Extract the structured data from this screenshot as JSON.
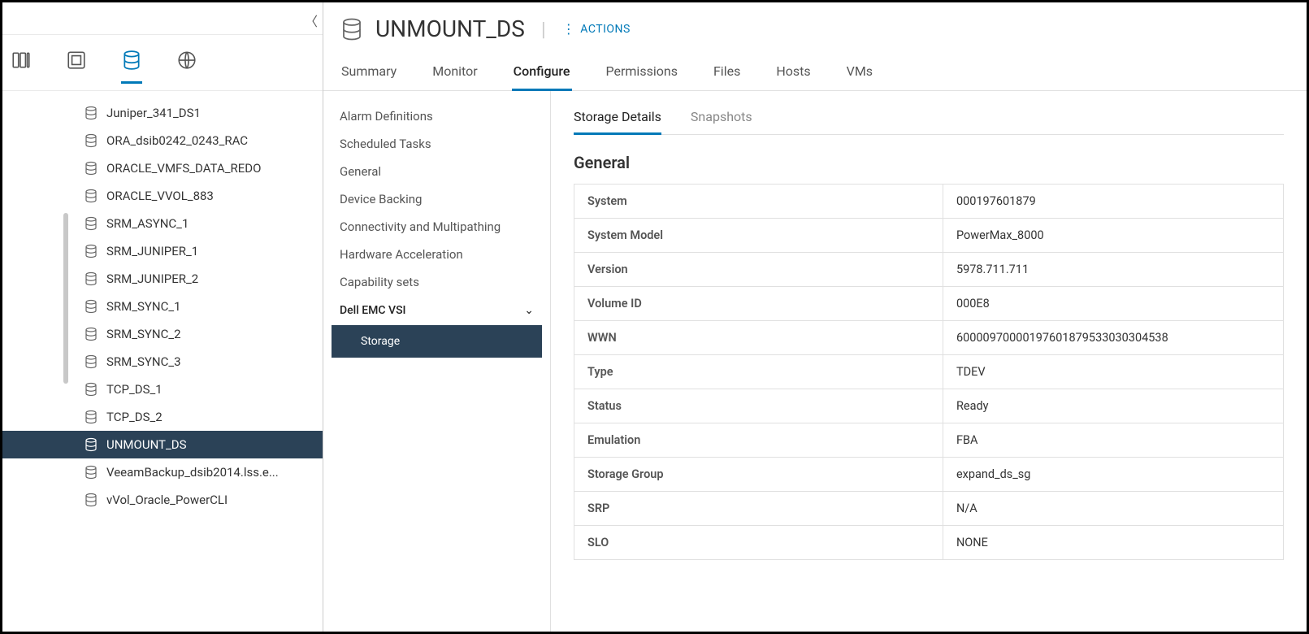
{
  "header": {
    "page_title": "UNMOUNT_DS",
    "actions_label": "ACTIONS"
  },
  "sidebar": {
    "items": [
      {
        "label": "Juniper_341_DS1"
      },
      {
        "label": "ORA_dsib0242_0243_RAC"
      },
      {
        "label": "ORACLE_VMFS_DATA_REDO"
      },
      {
        "label": "ORACLE_VVOL_883"
      },
      {
        "label": "SRM_ASYNC_1"
      },
      {
        "label": "SRM_JUNIPER_1"
      },
      {
        "label": "SRM_JUNIPER_2"
      },
      {
        "label": "SRM_SYNC_1"
      },
      {
        "label": "SRM_SYNC_2"
      },
      {
        "label": "SRM_SYNC_3"
      },
      {
        "label": "TCP_DS_1"
      },
      {
        "label": "TCP_DS_2"
      },
      {
        "label": "UNMOUNT_DS",
        "selected": true
      },
      {
        "label": "VeeamBackup_dsib2014.lss.e..."
      },
      {
        "label": "vVol_Oracle_PowerCLI"
      }
    ]
  },
  "main_tabs": [
    {
      "label": "Summary"
    },
    {
      "label": "Monitor"
    },
    {
      "label": "Configure",
      "active": true
    },
    {
      "label": "Permissions"
    },
    {
      "label": "Files"
    },
    {
      "label": "Hosts"
    },
    {
      "label": "VMs"
    }
  ],
  "config_nav": {
    "items": [
      "Alarm Definitions",
      "Scheduled Tasks",
      "General",
      "Device Backing",
      "Connectivity and Multipathing",
      "Hardware Acceleration",
      "Capability sets"
    ],
    "group": "Dell EMC VSI",
    "sub_selected": "Storage"
  },
  "sub_tabs": [
    {
      "label": "Storage Details",
      "active": true
    },
    {
      "label": "Snapshots"
    }
  ],
  "details": {
    "section_title": "General",
    "rows": [
      {
        "k": "System",
        "v": "000197601879"
      },
      {
        "k": "System Model",
        "v": "PowerMax_8000"
      },
      {
        "k": "Version",
        "v": "5978.711.711"
      },
      {
        "k": "Volume ID",
        "v": "000E8"
      },
      {
        "k": "WWN",
        "v": "60000970000197601879533030304538"
      },
      {
        "k": "Type",
        "v": "TDEV"
      },
      {
        "k": "Status",
        "v": "Ready"
      },
      {
        "k": "Emulation",
        "v": "FBA"
      },
      {
        "k": "Storage Group",
        "v": "expand_ds_sg"
      },
      {
        "k": "SRP",
        "v": "N/A"
      },
      {
        "k": "SLO",
        "v": "NONE"
      }
    ]
  }
}
